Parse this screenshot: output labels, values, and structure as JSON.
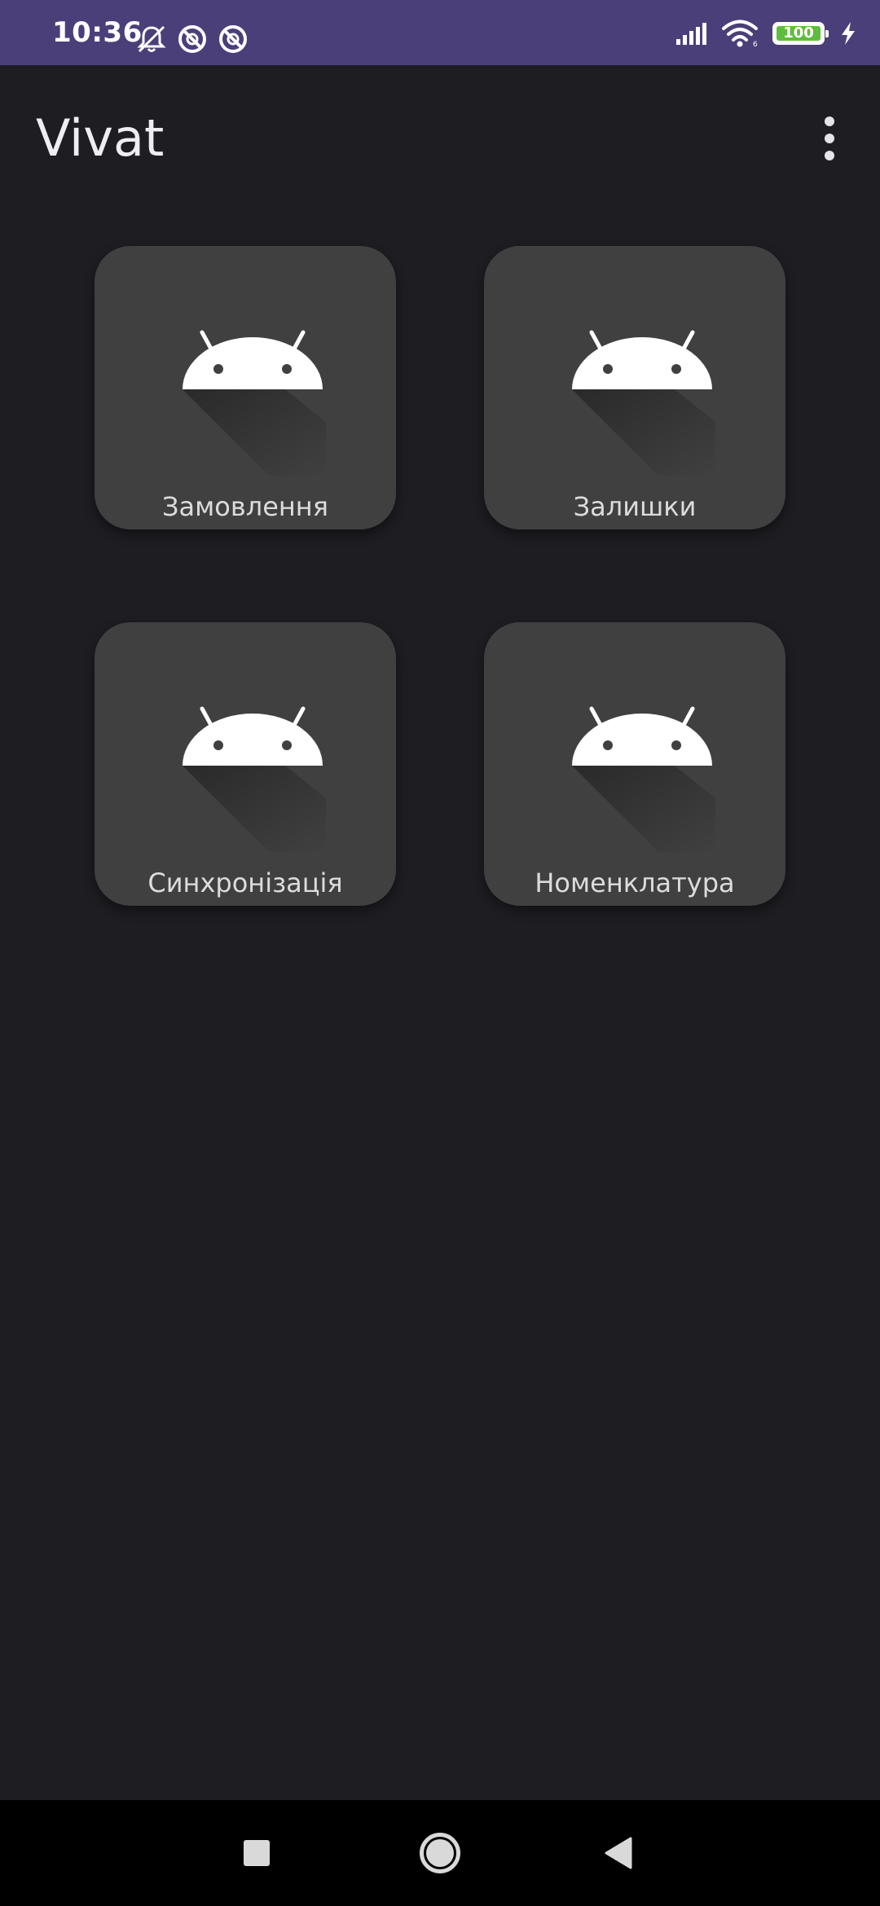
{
  "status_bar": {
    "time": "10:36",
    "battery_level": "100",
    "bg_color": "#4b3f7a",
    "icons": [
      "notifications-off-icon",
      "sync-disabled-icon",
      "sync-disabled-icon",
      "signal-icon",
      "wifi-icon",
      "battery-icon",
      "charging-icon"
    ]
  },
  "app_bar": {
    "title": "Vivat",
    "menu_icon": "more-vert-icon"
  },
  "tiles": [
    {
      "label": "Замовлення",
      "icon": "android-icon"
    },
    {
      "label": "Залишки",
      "icon": "android-icon"
    },
    {
      "label": "Синхронізація",
      "icon": "android-icon"
    },
    {
      "label": "Номенклатура",
      "icon": "android-icon"
    }
  ],
  "nav_bar": {
    "buttons": [
      "recents-icon",
      "home-icon",
      "back-icon"
    ]
  },
  "colors": {
    "background": "#1e1d22",
    "tile": "#404040",
    "accent": "#4b3f7a"
  }
}
